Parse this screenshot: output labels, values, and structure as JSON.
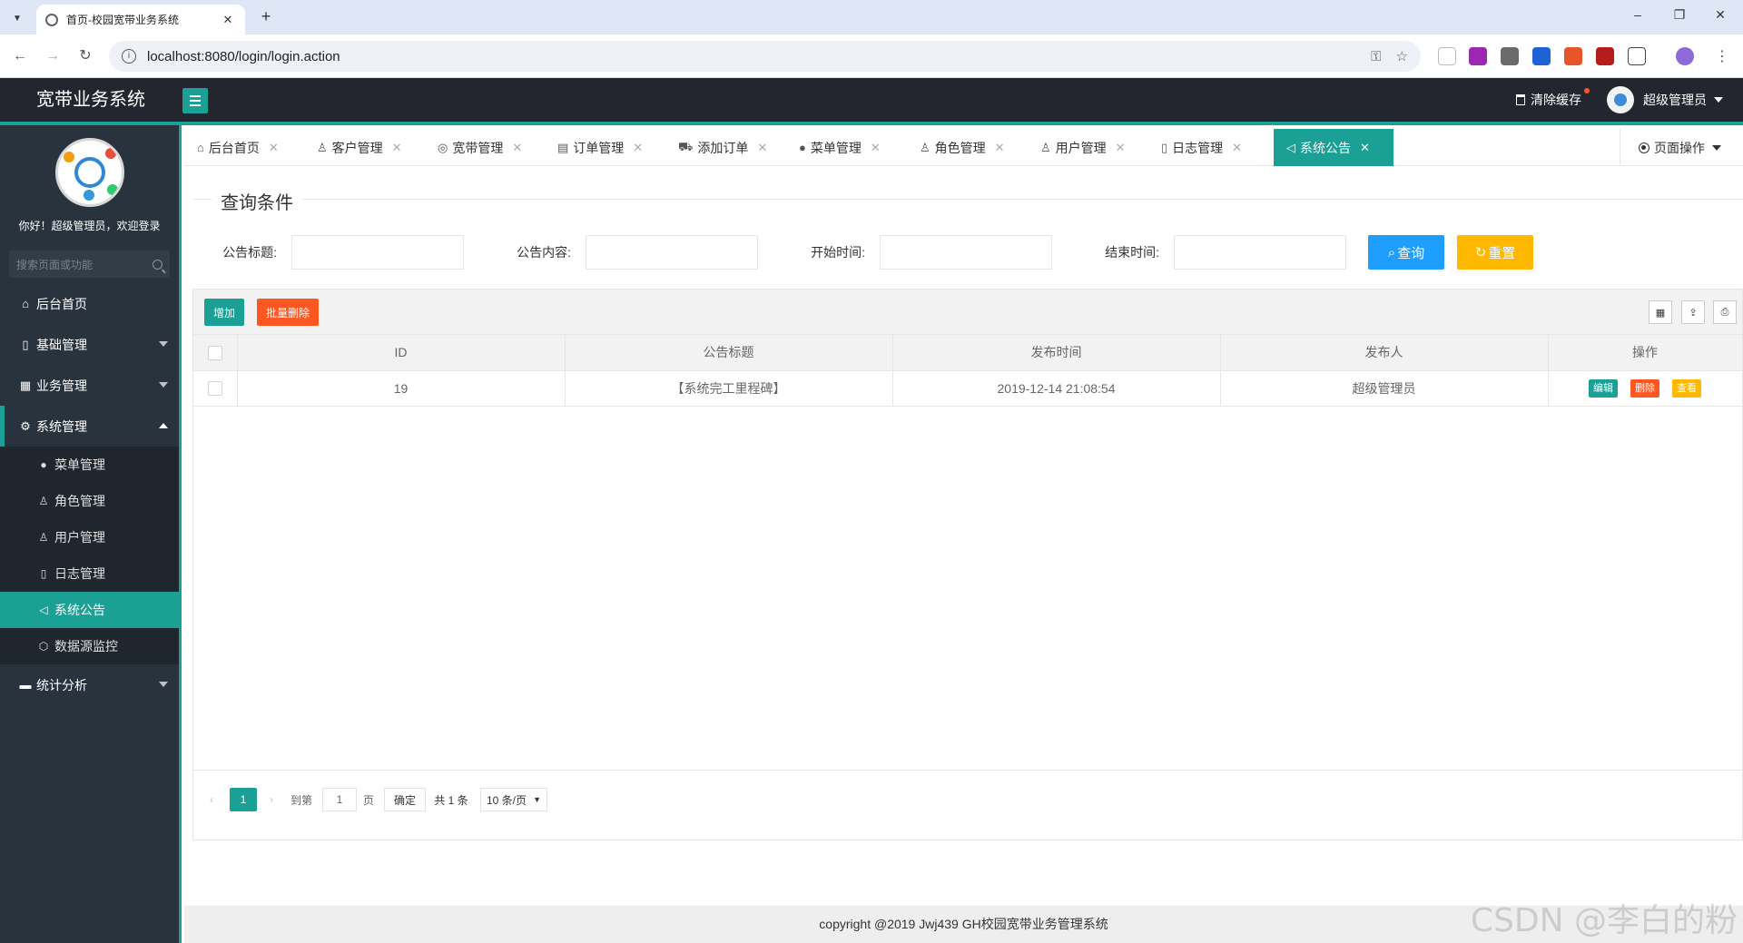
{
  "browser": {
    "tab_title": "首页-校园宽带业务系统",
    "tab_close": "✕",
    "new_tab": "+",
    "url": "localhost:8080/login/login.action",
    "win_min": "–",
    "win_restore": "❐",
    "win_close": "✕"
  },
  "header": {
    "logo": "宽带业务系统",
    "clear_cache": "清除缓存",
    "user": "超级管理员"
  },
  "sidebar": {
    "welcome": "你好！超级管理员，欢迎登录",
    "search_placeholder": "搜索页面或功能",
    "items": [
      {
        "label": "后台首页",
        "icon": "home-icon"
      },
      {
        "label": "基础管理",
        "icon": "file-icon"
      },
      {
        "label": "业务管理",
        "icon": "building-icon"
      },
      {
        "label": "系统管理",
        "icon": "gear-icon"
      },
      {
        "label": "统计分析",
        "icon": "chat-icon"
      }
    ],
    "sub_items": [
      {
        "label": "菜单管理",
        "icon": "circle-icon"
      },
      {
        "label": "角色管理",
        "icon": "user-icon"
      },
      {
        "label": "用户管理",
        "icon": "users-icon"
      },
      {
        "label": "日志管理",
        "icon": "note-icon"
      },
      {
        "label": "系统公告",
        "icon": "speaker-icon"
      },
      {
        "label": "数据源监控",
        "icon": "cube-icon"
      }
    ]
  },
  "tabs": [
    {
      "label": "后台首页",
      "icon": "⌂"
    },
    {
      "label": "客户管理",
      "icon": "♙"
    },
    {
      "label": "宽带管理",
      "icon": "◎"
    },
    {
      "label": "订单管理",
      "icon": "▤"
    },
    {
      "label": "添加订单",
      "icon": "⛟"
    },
    {
      "label": "菜单管理",
      "icon": "●"
    },
    {
      "label": "角色管理",
      "icon": "♙"
    },
    {
      "label": "用户管理",
      "icon": "♙"
    },
    {
      "label": "日志管理",
      "icon": "▯"
    },
    {
      "label": "系统公告",
      "icon": "◁"
    }
  ],
  "tab_close": "✕",
  "page_ops": "页面操作",
  "query": {
    "legend": "查询条件",
    "title_label": "公告标题:",
    "content_label": "公告内容:",
    "start_label": "开始时间:",
    "end_label": "结束时间:",
    "search_btn": "查询",
    "reset_btn": "重置"
  },
  "toolbar": {
    "add": "增加",
    "batch_delete": "批量删除"
  },
  "table": {
    "columns": [
      "ID",
      "公告标题",
      "发布时间",
      "发布人",
      "操作"
    ],
    "rows": [
      {
        "id": "19",
        "title": "【系统完工里程碑】",
        "time": "2019-12-14 21:08:54",
        "publisher": "超级管理员"
      }
    ],
    "ops": {
      "edit": "编辑",
      "delete": "删除",
      "view": "查看"
    }
  },
  "pager": {
    "current": "1",
    "goto": "到第",
    "page_input": "1",
    "page_unit": "页",
    "confirm": "确定",
    "total": "共 1 条",
    "per_page": "10 条/页"
  },
  "footer": "copyright @2019 Jwj439 GH校园宽带业务管理系统",
  "watermark": "CSDN @李白的粉",
  "colors": {
    "accent": "#1aa094",
    "search": "#1e9fff",
    "reset": "#ffb800",
    "danger": "#ff5722"
  }
}
